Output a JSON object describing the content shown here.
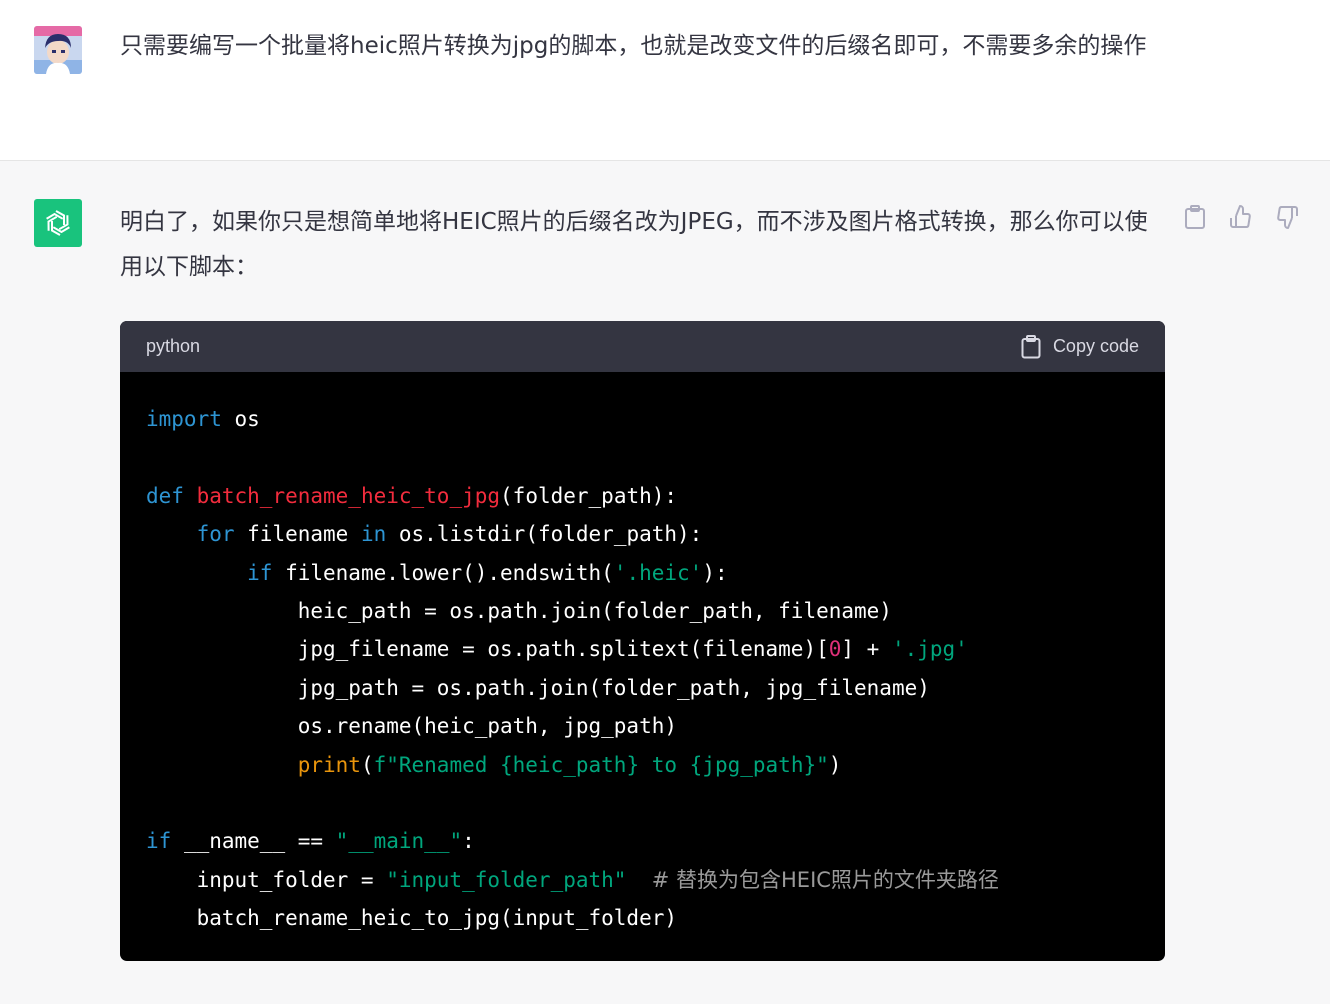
{
  "user": {
    "message": "只需要编写一个批量将heic照片转换为jpg的脚本，也就是改变文件的后缀名即可，不需要多余的操作"
  },
  "assistant": {
    "message": "明白了，如果你只是想简单地将HEIC照片的后缀名改为JPEG，而不涉及图片格式转换，那么你可以使用以下脚本：",
    "actions": [
      "clipboard-icon",
      "thumbs-up-icon",
      "thumbs-down-icon"
    ]
  },
  "code_block": {
    "language": "python",
    "copy_label": "Copy code",
    "lines": [
      [
        {
          "t": "import",
          "c": "kw"
        },
        {
          "t": " os"
        }
      ],
      [],
      [
        {
          "t": "def",
          "c": "kw"
        },
        {
          "t": " "
        },
        {
          "t": "batch_rename_heic_to_jpg",
          "c": "fn"
        },
        {
          "t": "(folder_path):"
        }
      ],
      [
        {
          "t": "    "
        },
        {
          "t": "for",
          "c": "kw"
        },
        {
          "t": " filename "
        },
        {
          "t": "in",
          "c": "kw"
        },
        {
          "t": " os.listdir(folder_path):"
        }
      ],
      [
        {
          "t": "        "
        },
        {
          "t": "if",
          "c": "kw"
        },
        {
          "t": " filename.lower().endswith("
        },
        {
          "t": "'.heic'",
          "c": "str"
        },
        {
          "t": "):"
        }
      ],
      [
        {
          "t": "            heic_path = os.path.join(folder_path, filename)"
        }
      ],
      [
        {
          "t": "            jpg_filename = os.path.splitext(filename)["
        },
        {
          "t": "0",
          "c": "num"
        },
        {
          "t": "] + "
        },
        {
          "t": "'.jpg'",
          "c": "str"
        }
      ],
      [
        {
          "t": "            jpg_path = os.path.join(folder_path, jpg_filename)"
        }
      ],
      [
        {
          "t": "            os.rename(heic_path, jpg_path)"
        }
      ],
      [
        {
          "t": "            "
        },
        {
          "t": "print",
          "c": "bi"
        },
        {
          "t": "("
        },
        {
          "t": "f\"Renamed {heic_path} to {jpg_path}\"",
          "c": "str"
        },
        {
          "t": ")"
        }
      ],
      [],
      [
        {
          "t": "if",
          "c": "kw"
        },
        {
          "t": " __name__ == "
        },
        {
          "t": "\"__main__\"",
          "c": "str"
        },
        {
          "t": ":"
        }
      ],
      [
        {
          "t": "    input_folder = "
        },
        {
          "t": "\"input_folder_path\"",
          "c": "str"
        },
        {
          "t": "  "
        },
        {
          "t": "# 替换为包含HEIC照片的文件夹路径",
          "c": "cm"
        }
      ],
      [
        {
          "t": "    batch_rename_heic_to_jpg(input_folder)"
        }
      ]
    ]
  },
  "colors": {
    "keyword": "#2e95d3",
    "function": "#f22c3d",
    "string": "#00a67d",
    "number": "#df3079",
    "builtin": "#e9950c",
    "comment": "#9a9a9a",
    "gpt_brand": "#19c37d"
  }
}
